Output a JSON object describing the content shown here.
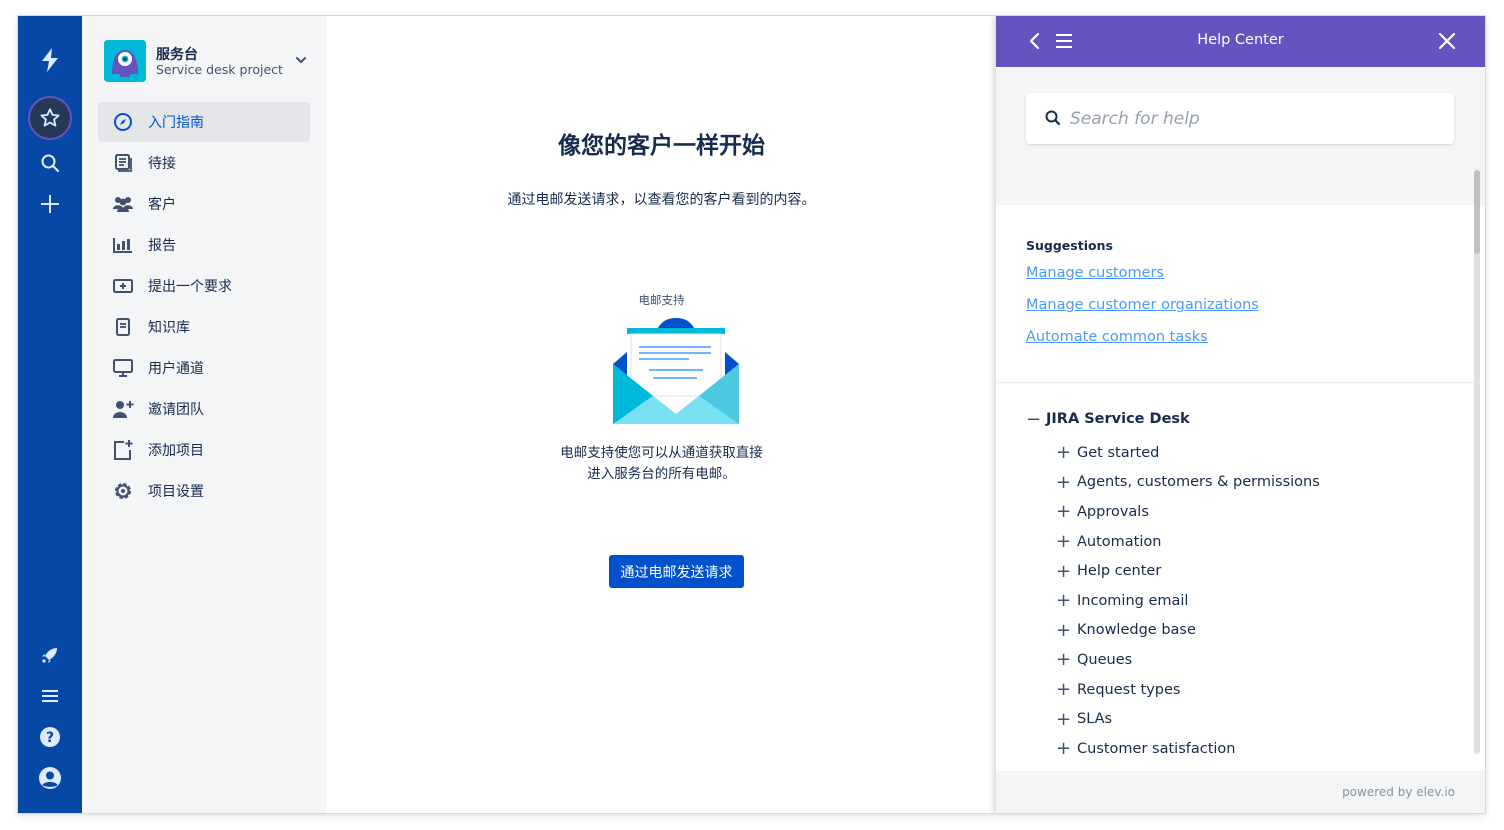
{
  "globalnav": {
    "icons": [
      "jira-logo-icon",
      "star-icon",
      "search-icon",
      "plus-icon",
      "rocket-icon",
      "menu-icon",
      "help-icon",
      "profile-icon"
    ]
  },
  "project": {
    "name": "服务台",
    "type": "Service desk project"
  },
  "sidebar": {
    "items": [
      {
        "label": "入门指南",
        "icon": "compass-icon",
        "active": true
      },
      {
        "label": "待接",
        "icon": "queue-icon"
      },
      {
        "label": "客户",
        "icon": "people-icon"
      },
      {
        "label": "报告",
        "icon": "chart-icon"
      },
      {
        "label": "提出一个要求",
        "icon": "raise-request-icon"
      },
      {
        "label": "知识库",
        "icon": "book-icon"
      },
      {
        "label": "用户通道",
        "icon": "monitor-icon"
      },
      {
        "label": "邀请团队",
        "icon": "add-person-icon"
      },
      {
        "label": "添加项目",
        "icon": "add-item-icon"
      },
      {
        "label": "项目设置",
        "icon": "gear-icon"
      }
    ]
  },
  "main": {
    "title": "像您的客户一样开始",
    "subtitle": "通过电邮发送请求，以查看您的客户看到的内容。",
    "illustration_label": "电邮支持",
    "description_line1": "电邮支持使您可以从通道获取直接",
    "description_line2": "进入服务台的所有电邮。",
    "cta_label": "通过电邮发送请求"
  },
  "help": {
    "title": "Help Center",
    "search_placeholder": "Search for help",
    "suggestions_heading": "Suggestions",
    "suggestions": [
      "Manage customers",
      "Manage customer organizations",
      "Automate common tasks"
    ],
    "tree_root": "JIRA Service Desk",
    "tree_items": [
      "Get started",
      "Agents, customers & permissions",
      "Approvals",
      "Automation",
      "Help center",
      "Incoming email",
      "Knowledge base",
      "Queues",
      "Request types",
      "SLAs",
      "Customer satisfaction"
    ],
    "powered_by": "powered by elev.io"
  },
  "colors": {
    "globalnav": "#0747a6",
    "help_header": "#6554c0",
    "primary_button": "#0052cc",
    "link": "#4c9aff"
  }
}
